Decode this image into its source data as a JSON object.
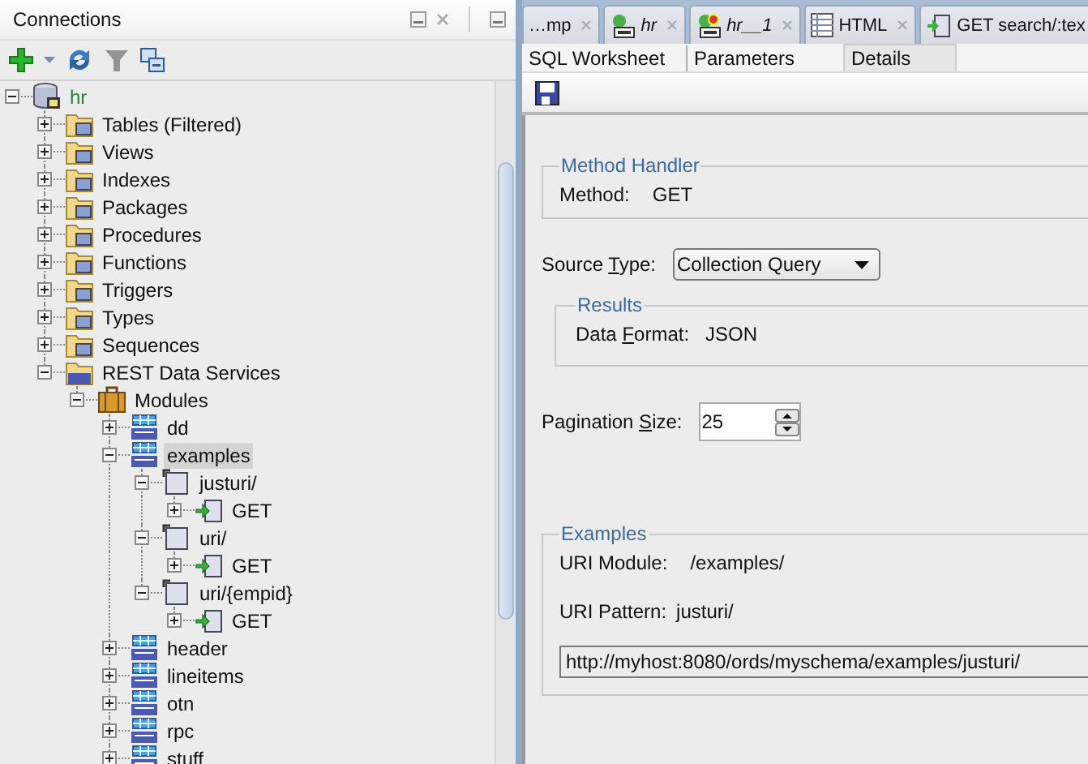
{
  "connections_panel": {
    "title": "Connections",
    "toolbar": [
      {
        "kind": "add",
        "disabled": false
      },
      {
        "kind": "dropdown",
        "disabled": false
      },
      {
        "kind": "refresh",
        "disabled": false
      },
      {
        "kind": "filter",
        "disabled": true
      },
      {
        "kind": "collapse",
        "disabled": false
      }
    ]
  },
  "tree": [
    {
      "label": "hr",
      "kind": "connection",
      "expanded": true,
      "selected": false,
      "children": [
        {
          "label": "Tables (Filtered)",
          "kind": "folder",
          "expanded": false,
          "selected": false
        },
        {
          "label": "Views",
          "kind": "folder",
          "expanded": false,
          "selected": false
        },
        {
          "label": "Indexes",
          "kind": "folder",
          "expanded": false,
          "selected": false
        },
        {
          "label": "Packages",
          "kind": "folder",
          "expanded": false,
          "selected": false
        },
        {
          "label": "Procedures",
          "kind": "folder",
          "expanded": false,
          "selected": false
        },
        {
          "label": "Functions",
          "kind": "folder",
          "expanded": false,
          "selected": false
        },
        {
          "label": "Triggers",
          "kind": "folder",
          "expanded": false,
          "selected": false
        },
        {
          "label": "Types",
          "kind": "folder",
          "expanded": false,
          "selected": false
        },
        {
          "label": "Sequences",
          "kind": "folder",
          "expanded": false,
          "selected": false
        },
        {
          "label": "REST Data Services",
          "kind": "rest-folder",
          "expanded": true,
          "selected": false,
          "children": [
            {
              "label": "Modules",
              "kind": "modules",
              "expanded": true,
              "selected": false,
              "children": [
                {
                  "label": "dd",
                  "kind": "module",
                  "expanded": false,
                  "selected": false
                },
                {
                  "label": "examples",
                  "kind": "module",
                  "expanded": true,
                  "selected": true,
                  "children": [
                    {
                      "label": "justuri/",
                      "kind": "template",
                      "expanded": true,
                      "selected": false,
                      "children": [
                        {
                          "label": "GET",
                          "kind": "handler",
                          "expanded": false,
                          "selected": false
                        }
                      ]
                    },
                    {
                      "label": "uri/",
                      "kind": "template",
                      "expanded": true,
                      "selected": false,
                      "children": [
                        {
                          "label": "GET",
                          "kind": "handler",
                          "expanded": false,
                          "selected": false
                        }
                      ]
                    },
                    {
                      "label": "uri/{empid}",
                      "kind": "template",
                      "expanded": true,
                      "selected": false,
                      "children": [
                        {
                          "label": "GET",
                          "kind": "handler",
                          "expanded": false,
                          "selected": false
                        }
                      ]
                    }
                  ]
                },
                {
                  "label": "header",
                  "kind": "module",
                  "expanded": false,
                  "selected": false
                },
                {
                  "label": "lineitems",
                  "kind": "module",
                  "expanded": false,
                  "selected": false
                },
                {
                  "label": "otn",
                  "kind": "module",
                  "expanded": false,
                  "selected": false
                },
                {
                  "label": "rpc",
                  "kind": "module",
                  "expanded": false,
                  "selected": false
                },
                {
                  "label": "stuff",
                  "kind": "module",
                  "expanded": false,
                  "selected": false
                }
              ]
            }
          ]
        }
      ]
    }
  ],
  "editor_tabs": [
    {
      "label": "…mp",
      "kind": "plain",
      "modified": false
    },
    {
      "label": "hr",
      "kind": "worksheet",
      "modified": true
    },
    {
      "label": "hr__1",
      "kind": "new-worksheet",
      "modified": true
    },
    {
      "label": "HTML",
      "kind": "report",
      "modified": false
    },
    {
      "label": "GET search/:tex",
      "kind": "handler",
      "modified": false
    }
  ],
  "sub_tabs": [
    {
      "label": "SQL Worksheet",
      "selected": false
    },
    {
      "label": "Parameters",
      "selected": false
    },
    {
      "label": "Details",
      "selected": true
    }
  ],
  "method_handler": {
    "title": "Method Handler",
    "method_label": "Method:",
    "method": "GET"
  },
  "source_type": {
    "label": {
      "before": "Source ",
      "key": "T",
      "after": "ype:"
    },
    "value": "Collection Query"
  },
  "results": {
    "title": "Results",
    "data_format_label": {
      "before": "Data ",
      "key": "F",
      "after": "ormat:"
    },
    "data_format": "JSON"
  },
  "pagination_size": {
    "label": {
      "before": "Pagination ",
      "key": "S",
      "after": "ize:"
    },
    "value": "25"
  },
  "examples": {
    "title": "Examples",
    "uri_module_label": "URI Module:",
    "uri_module": "/examples/",
    "uri_pattern_label": "URI Pattern:",
    "uri_pattern": "justuri/",
    "url": "http://myhost:8080/ords/myschema/examples/justuri/"
  }
}
